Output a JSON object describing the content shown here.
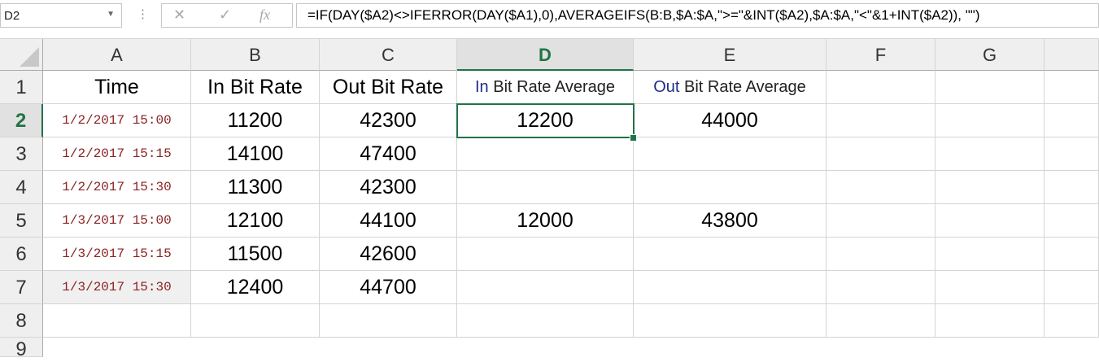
{
  "formula_bar": {
    "name_box": "D2",
    "dots": "⋮",
    "cancel_glyph": "✕",
    "enter_glyph": "✓",
    "fx_glyph": "fx",
    "formula": "=IF(DAY($A2)<>IFERROR(DAY($A1),0),AVERAGEIFS(B:B,$A:$A,\">=\"&INT($A2),$A:$A,\"<\"&1+INT($A2)), \"\")"
  },
  "columns": [
    "A",
    "B",
    "C",
    "D",
    "E",
    "F",
    "G"
  ],
  "rows": [
    "1",
    "2",
    "3",
    "4",
    "5",
    "6",
    "7",
    "8",
    "9"
  ],
  "header_row": {
    "a": "Time",
    "b": "In Bit Rate",
    "c": "Out Bit Rate",
    "d_prefix": "In",
    "d_rest": " Bit Rate Average",
    "e_prefix": "Out",
    "e_rest": " Bit Rate Average"
  },
  "data_rows": [
    {
      "time": "1/2/2017 15:00",
      "in": "11200",
      "out": "42300",
      "in_avg": "12200",
      "out_avg": "44000"
    },
    {
      "time": "1/2/2017 15:15",
      "in": "14100",
      "out": "47400",
      "in_avg": "",
      "out_avg": ""
    },
    {
      "time": "1/2/2017 15:30",
      "in": "11300",
      "out": "42300",
      "in_avg": "",
      "out_avg": ""
    },
    {
      "time": "1/3/2017 15:00",
      "in": "12100",
      "out": "44100",
      "in_avg": "12000",
      "out_avg": "43800"
    },
    {
      "time": "1/3/2017 15:15",
      "in": "11500",
      "out": "42600",
      "in_avg": "",
      "out_avg": ""
    },
    {
      "time": "1/3/2017 15:30",
      "in": "12400",
      "out": "44700",
      "in_avg": "",
      "out_avg": ""
    }
  ],
  "colors": {
    "accent": "#217346",
    "time_text": "#8b2323",
    "header_blue": "#1f2d86"
  }
}
